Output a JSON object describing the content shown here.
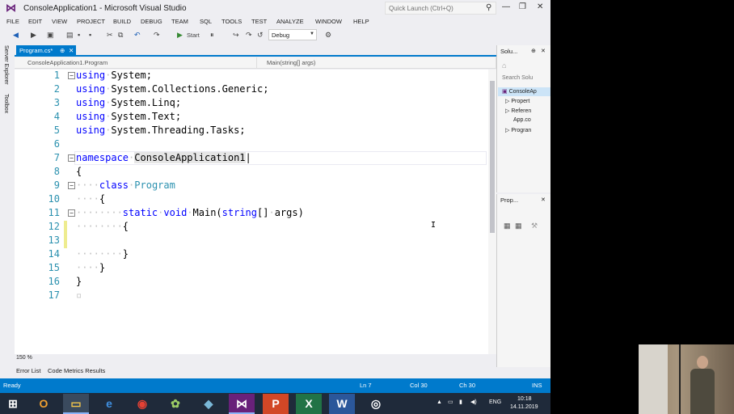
{
  "window": {
    "title": "ConsoleApplication1 - Microsoft Visual Studio",
    "quick_launch_placeholder": "Quick Launch (Ctrl+Q)"
  },
  "menu": [
    "FILE",
    "EDIT",
    "VIEW",
    "PROJECT",
    "BUILD",
    "DEBUG",
    "TEAM",
    "SQL",
    "TOOLS",
    "TEST",
    "ANALYZE",
    "WINDOW",
    "HELP"
  ],
  "toolbar": {
    "start_label": "Start",
    "config": "Debug"
  },
  "left_tabs": [
    "Server Explorer",
    "Toolbox"
  ],
  "doc_tab": {
    "label": "Program.cs*",
    "pin": "⊕",
    "close": "✕"
  },
  "navbar": {
    "left": "ConsoleApplication1.Program",
    "right": "Main(string[] args)"
  },
  "editor": {
    "line_numbers": [
      "1",
      "2",
      "3",
      "4",
      "5",
      "6",
      "7",
      "8",
      "9",
      "10",
      "11",
      "12",
      "13",
      "14",
      "15",
      "16",
      "17"
    ]
  },
  "zoom": "150 %",
  "bottom_tabs": [
    "Error List",
    "Code Metrics Results"
  ],
  "solution_explorer": {
    "title": "Solu...",
    "search_placeholder": "Search Solu",
    "items": [
      "ConsoleAp",
      "Propert",
      "Referen",
      "App.co",
      "Progran"
    ]
  },
  "properties": {
    "title": "Prop..."
  },
  "status": {
    "ready": "Ready",
    "line": "Ln 7",
    "col": "Col 30",
    "ch": "Ch 30",
    "mode": "INS"
  },
  "taskbar": {
    "tray_lang": "ENG",
    "time": "10:18",
    "date": "14.11.2019"
  },
  "colors": {
    "accent": "#007acc",
    "keyword": "#0000ff",
    "type": "#2b91af"
  }
}
